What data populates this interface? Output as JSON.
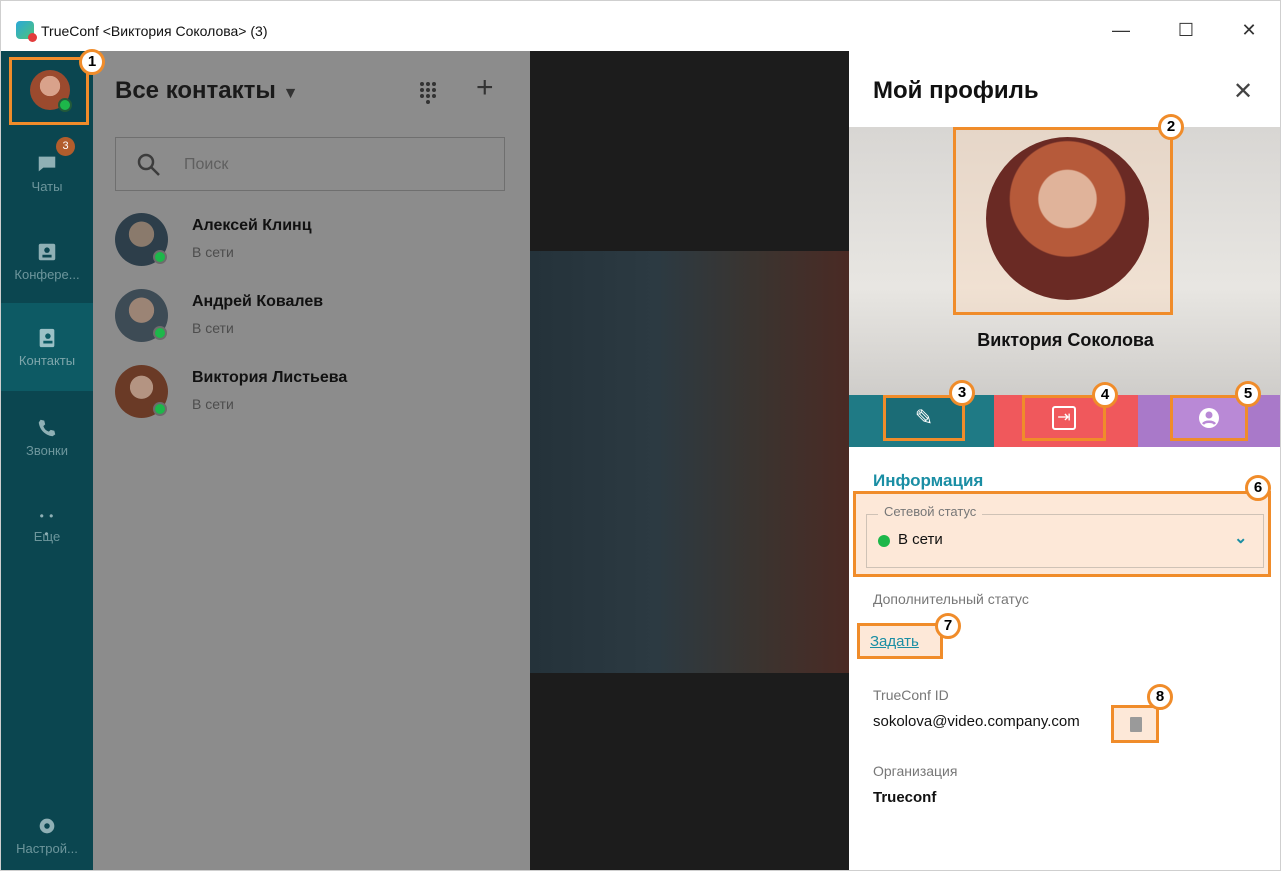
{
  "window": {
    "title": "TrueConf <Виктория Соколова> (3)",
    "controls": {
      "minimize": "—",
      "maximize": "☐",
      "close": "✕"
    }
  },
  "callouts": [
    "1",
    "2",
    "3",
    "4",
    "5",
    "6",
    "7",
    "8"
  ],
  "sidebar": {
    "items": [
      {
        "label": "Чаты",
        "icon": "chat-icon",
        "badge": "3"
      },
      {
        "label": "Конфере...",
        "icon": "conference-icon"
      },
      {
        "label": "Контакты",
        "icon": "contacts-icon"
      },
      {
        "label": "Звонки",
        "icon": "calls-icon"
      },
      {
        "label": "Еще",
        "icon": "more-icon",
        "glyph": "• • •"
      }
    ],
    "settings_label": "Настрой..."
  },
  "contacts": {
    "title": "Все контакты",
    "title_arrow": "▼",
    "add_label": "+",
    "search_placeholder": "Поиск",
    "list": [
      {
        "name": "Алексей Клинц",
        "status": "В сети"
      },
      {
        "name": "Андрей Ковалев",
        "status": "В сети"
      },
      {
        "name": "Виктория Листьева",
        "status": "В сети"
      }
    ]
  },
  "profile": {
    "title": "Мой профиль",
    "close": "✕",
    "name": "Виктория Соколова",
    "edit_icon": "✎",
    "logout_icon": "⇥",
    "info_header": "Информация",
    "network_status_label": "Сетевой статус",
    "network_status_value": "В сети",
    "network_status_chevron": "⌄",
    "extra_status_label": "Дополнительный статус",
    "set_link": "Задать",
    "trueconf_id_label": "TrueConf ID",
    "trueconf_id_value": "sokolova@video.company.com",
    "org_label": "Организация",
    "org_value": "Trueconf"
  },
  "colors": {
    "accent": "#f08c2a",
    "teal": "#1a8ea4",
    "online": "#1db74a",
    "rail": "#0b4650",
    "edit_bar": "#1f7a85",
    "logout_bar": "#f0585c",
    "profile_bar": "#a979c9"
  }
}
